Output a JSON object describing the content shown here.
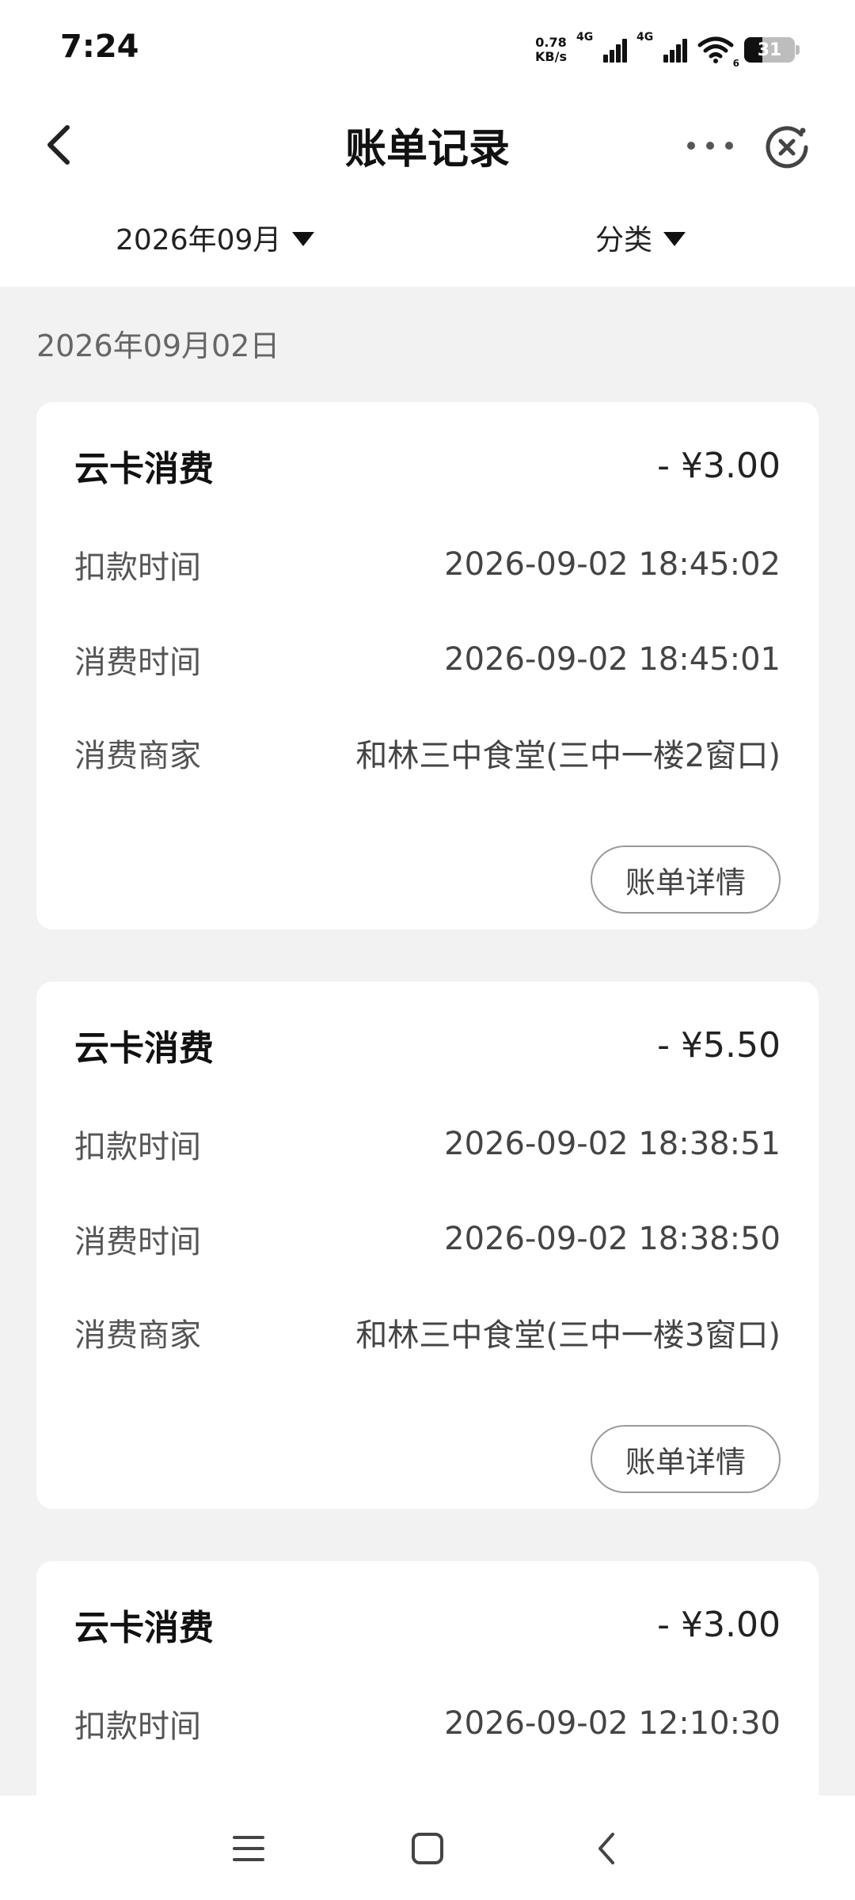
{
  "status_bar": {
    "time": "7:24",
    "net_speed_value": "0.78",
    "net_speed_unit": "KB/s",
    "network_1": "4G",
    "network_2": "4G",
    "wifi_label": "6",
    "battery": "31"
  },
  "header": {
    "title": "账单记录"
  },
  "filters": {
    "month": "2026年09月",
    "category": "分类"
  },
  "date_group": "2026年09月02日",
  "labels": {
    "deduct_time": "扣款时间",
    "consume_time": "消费时间",
    "merchant": "消费商家",
    "detail_button": "账单详情"
  },
  "records": [
    {
      "type": "云卡消费",
      "amount": "- ¥3.00",
      "deduct_time": "2026-09-02 18:45:02",
      "consume_time": "2026-09-02 18:45:01",
      "merchant": "和林三中食堂(三中一楼2窗口)"
    },
    {
      "type": "云卡消费",
      "amount": "- ¥5.50",
      "deduct_time": "2026-09-02 18:38:51",
      "consume_time": "2026-09-02 18:38:50",
      "merchant": "和林三中食堂(三中一楼3窗口)"
    },
    {
      "type": "云卡消费",
      "amount": "- ¥3.00",
      "deduct_time": "2026-09-02 12:10:30"
    }
  ],
  "icons": {
    "back": "back-arrow-icon",
    "more": "more-dots-icon",
    "close": "close-circle-icon",
    "nav_menu": "menu-icon",
    "nav_home": "home-square-icon",
    "nav_back": "back-chevron-icon"
  }
}
